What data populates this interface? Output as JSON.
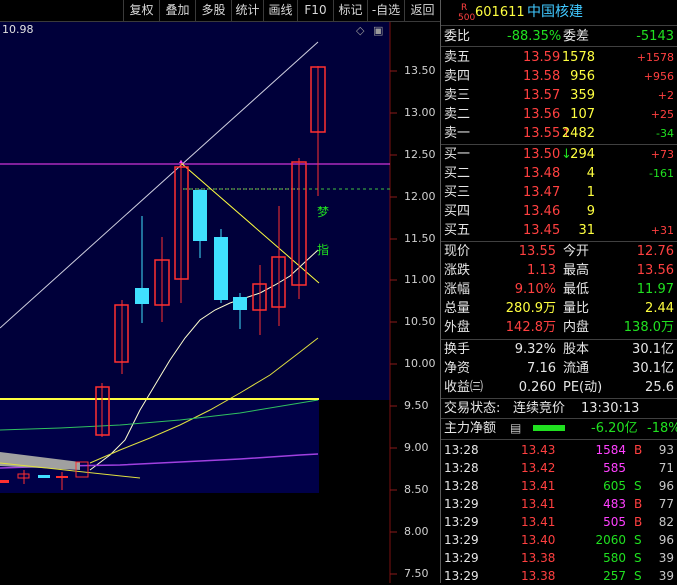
{
  "toolbar": {
    "buttons": [
      "复权",
      "叠加",
      "多股",
      "统计",
      "画线",
      "F10",
      "标记",
      "-自选",
      "返回"
    ]
  },
  "chart": {
    "price_label": "10.98",
    "ctrl_diamond": "◇",
    "ctrl_box": "▣",
    "y_ticks": [
      "13.50",
      "13.00",
      "12.50",
      "12.00",
      "11.50",
      "11.00",
      "10.50",
      "10.00",
      "9.50",
      "9.00",
      "8.50",
      "8.00",
      "7.50"
    ],
    "signal_1": "梦",
    "signal_2": "指"
  },
  "header": {
    "r_label": "R",
    "r_num": "500",
    "code": "601611",
    "name": "中国核建"
  },
  "commission": {
    "label1": "委比",
    "value1": "-88.35%",
    "label2": "委差",
    "value2": "-5143"
  },
  "asks": [
    {
      "label": "卖五",
      "price": "13.59",
      "vol": "1578",
      "chg": "+1578"
    },
    {
      "label": "卖四",
      "price": "13.58",
      "vol": "956",
      "chg": "+956"
    },
    {
      "label": "卖三",
      "price": "13.57",
      "vol": "359",
      "chg": "+2"
    },
    {
      "label": "卖二",
      "price": "13.56",
      "vol": "107",
      "chg": "+25"
    },
    {
      "label": "卖一",
      "price": "13.55",
      "arrow": "↑",
      "vol": "2482",
      "chg": "-34"
    }
  ],
  "bids": [
    {
      "label": "买一",
      "price": "13.50",
      "arrow": "↓",
      "vol": "294",
      "chg": "+73"
    },
    {
      "label": "买二",
      "price": "13.48",
      "vol": "4",
      "chg": "-161"
    },
    {
      "label": "买三",
      "price": "13.47",
      "vol": "1",
      "chg": ""
    },
    {
      "label": "买四",
      "price": "13.46",
      "vol": "9",
      "chg": ""
    },
    {
      "label": "买五",
      "price": "13.45",
      "vol": "31",
      "chg": "+31"
    }
  ],
  "quote": [
    {
      "l1": "现价",
      "v1": "13.55",
      "l2": "今开",
      "v2": "12.76"
    },
    {
      "l1": "涨跌",
      "v1": "1.13",
      "l2": "最高",
      "v2": "13.56"
    },
    {
      "l1": "涨幅",
      "v1": "9.10%",
      "l2": "最低",
      "v2": "11.97"
    },
    {
      "l1": "总量",
      "v1": "280.9万",
      "l2": "量比",
      "v2": "2.44"
    },
    {
      "l1": "外盘",
      "v1": "142.8万",
      "l2": "内盘",
      "v2": "138.0万"
    }
  ],
  "stats": [
    {
      "l1": "换手",
      "v1": "9.32%",
      "l2": "股本",
      "v2": "30.1亿"
    },
    {
      "l1": "净资",
      "v1": "7.16",
      "l2": "流通",
      "v2": "30.1亿"
    },
    {
      "l1": "收益㈢",
      "v1": "0.260",
      "l2": "PE(动)",
      "v2": "25.6"
    }
  ],
  "trade_status": {
    "label": "交易状态:",
    "value": "连续竞价",
    "time": "13:30:13"
  },
  "main_flow": {
    "label": "主力净额",
    "value": "-6.20亿",
    "pct": "-18%"
  },
  "ticks": [
    {
      "time": "13:28",
      "price": "13.43",
      "vol": "1584",
      "side": "B",
      "n": "93"
    },
    {
      "time": "13:28",
      "price": "13.42",
      "vol": "585",
      "side": "",
      "n": "71"
    },
    {
      "time": "13:28",
      "price": "13.41",
      "vol": "605",
      "side": "S",
      "n": "96"
    },
    {
      "time": "13:29",
      "price": "13.41",
      "vol": "483",
      "side": "B",
      "n": "77"
    },
    {
      "time": "13:29",
      "price": "13.41",
      "vol": "505",
      "side": "B",
      "n": "82"
    },
    {
      "time": "13:29",
      "price": "13.40",
      "vol": "2060",
      "side": "S",
      "n": "96"
    },
    {
      "time": "13:29",
      "price": "13.38",
      "vol": "580",
      "side": "S",
      "n": "39"
    },
    {
      "time": "13:29",
      "price": "13.38",
      "vol": "257",
      "side": "S",
      "n": "39"
    }
  ]
}
